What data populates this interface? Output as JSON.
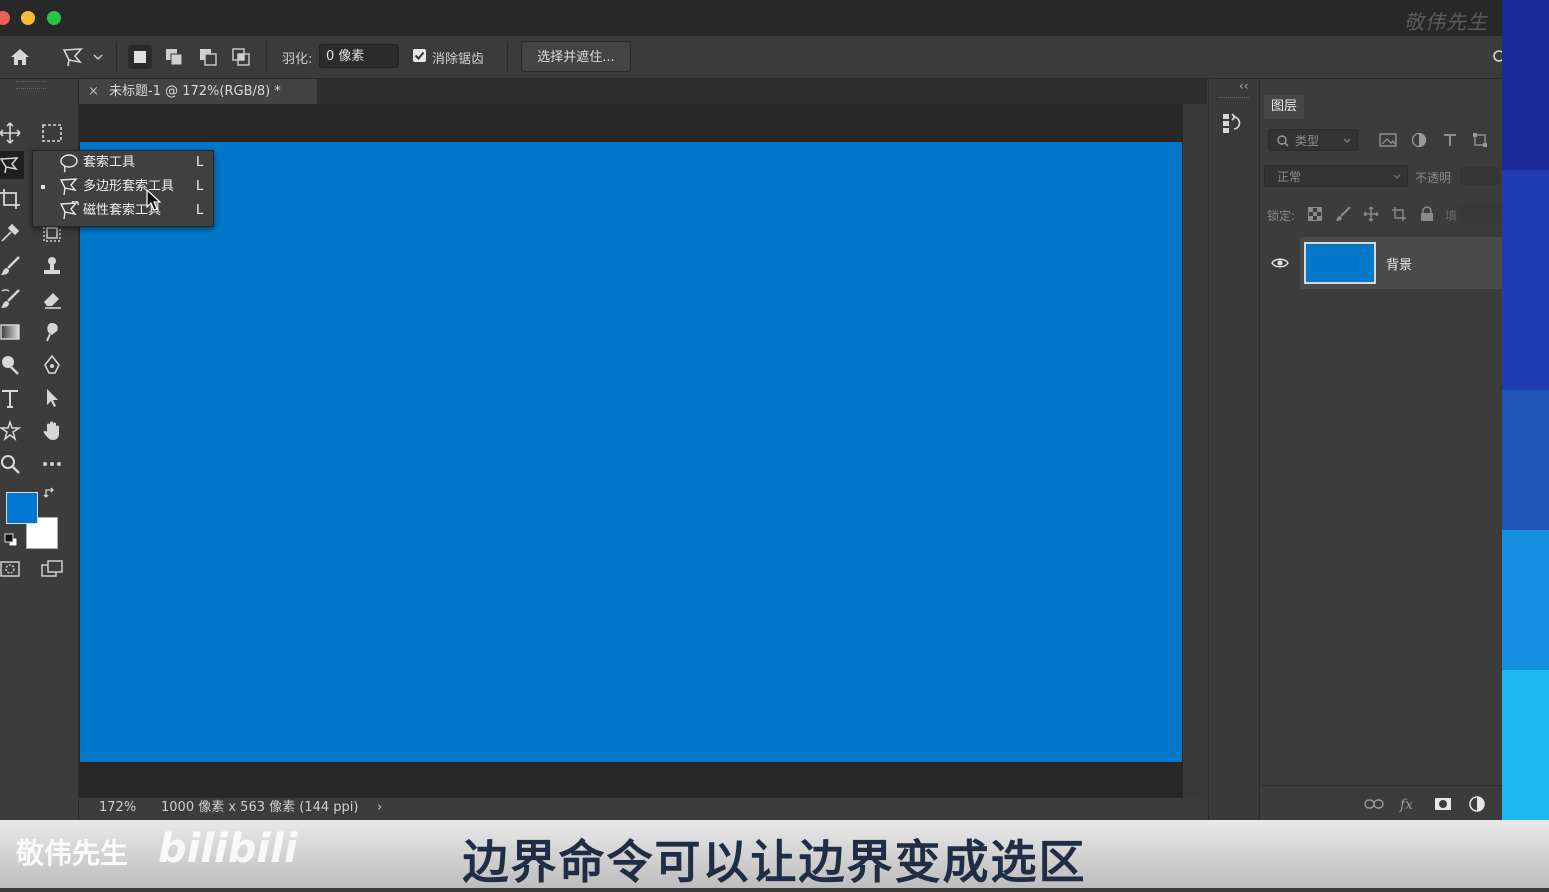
{
  "watermark_top": "敬伟先生",
  "options_bar": {
    "feather_label": "羽化:",
    "feather_value": "0 像素",
    "antialias_label": "消除锯齿",
    "select_mask_button": "选择并遮住..."
  },
  "document": {
    "tab_title": "未标题-1 @ 172%(RGB/8) *",
    "close_glyph": "×",
    "canvas_color": "#0077c8"
  },
  "flyout": {
    "items": [
      {
        "label": "套索工具",
        "key": "L",
        "icon": "lasso-icon",
        "selected": false
      },
      {
        "label": "多边形套索工具",
        "key": "L",
        "icon": "polygonal-lasso-icon",
        "selected": true
      },
      {
        "label": "磁性套索工具",
        "key": "L",
        "icon": "magnetic-lasso-icon",
        "selected": false
      }
    ]
  },
  "status_bar": {
    "zoom": "172%",
    "doc_info": "1000 像素 x 563 像素 (144 ppi)",
    "arrow": "›"
  },
  "layers_panel": {
    "tab_label": "图层",
    "filter_placeholder": "类型",
    "blend_mode": "正常",
    "opacity_label": "不透明",
    "lock_label": "锁定:",
    "fill_label": "填",
    "layer_name": "背景",
    "collapse_glyph": "‹‹"
  },
  "colors": {
    "foreground": "#0078d4",
    "background": "#ffffff",
    "accent_blue": "#0077c8"
  },
  "subtitle": {
    "text": "边界命令可以让边界变成选区",
    "watermark_name": "敬伟先生",
    "watermark_logo": "bilibili"
  }
}
